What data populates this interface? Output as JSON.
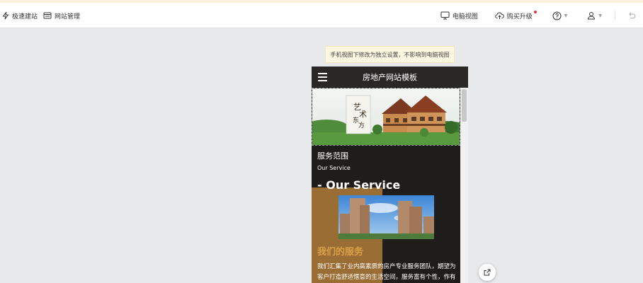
{
  "toolbar": {
    "quick_build": "极速建站",
    "site_manage": "网站管理",
    "desktop_view": "电脑视图",
    "buy_upgrade": "购买升级"
  },
  "notice": "手机视图下修改为独立设置，不影响到电脑视图",
  "phone": {
    "title": "房地产网站模板",
    "banner_logo": "艺术东方",
    "section_title": "服务范围",
    "section_subtitle": "Our Service",
    "big_title": "- Our Service",
    "services_heading": "我们的服务",
    "paragraph": "我们汇集了业内高素质的房产专业服务团队，期望为客户打造舒适惬意的生活空间，服务富有个性，作有幸于"
  },
  "colors": {
    "accent_gold": "#d9a04a",
    "brown_block": "#9a6d34",
    "phone_bg": "#1f1d1c",
    "notice_bg": "#fdf6e0"
  },
  "icons": [
    "lightning-icon",
    "window-icon",
    "monitor-icon",
    "cloud-upload-icon",
    "help-icon",
    "user-icon",
    "undo-icon",
    "share-icon"
  ]
}
